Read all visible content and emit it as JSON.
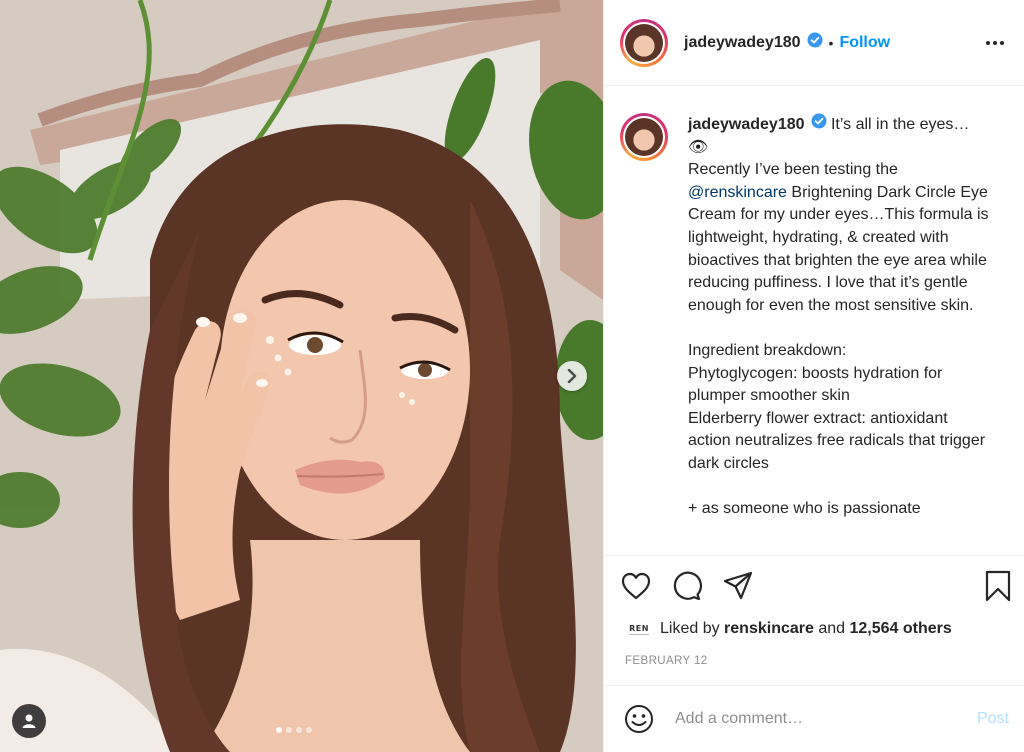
{
  "post": {
    "username": "jadeywadey180",
    "separator": "•",
    "follow_label": "Follow",
    "caption_lead": " It’s all in the eyes… 👁",
    "caption_pre_mention": "Recently I’ve been testing the ",
    "caption_mention": "@renskincare",
    "caption_post_mention": " Brightening Dark Circle Eye Cream for my under eyes…This formula is lightweight, hydrating, & created with bioactives that brighten the eye area while reducing puffiness. I love that it’s gentle enough for even the most sensitive skin.\n\nIngredient breakdown:\nPhytoglycogen: boosts hydration for plumper smoother skin\nElderberry flower extract: antioxidant action neutralizes free radicals that trigger dark circles\n\n+ as someone who is passionate",
    "liked_by_prefix": "Liked by",
    "liked_by_user": "renskincare",
    "liked_by_and": "and",
    "liked_by_others": "12,564 others",
    "date": "FEBRUARY 12",
    "ren_logo_text": "REN"
  },
  "comment": {
    "placeholder": "Add a comment…",
    "post_label": "Post"
  },
  "carousel": {
    "total_slides": 4,
    "active_slide": 1
  },
  "colors": {
    "accent_blue": "#0095f6",
    "mention_blue": "#00376b",
    "post_disabled": "#b2dffc",
    "verified_blue": "#3897f0",
    "muted_text": "#8e8e8e"
  },
  "icons": {
    "like": "heart-icon",
    "comment": "comment-icon",
    "share": "paper-plane-icon",
    "save": "bookmark-icon",
    "more": "more-options-icon",
    "next": "chevron-right-icon",
    "emoji": "emoji-icon",
    "user_tags": "user-tag-icon"
  }
}
